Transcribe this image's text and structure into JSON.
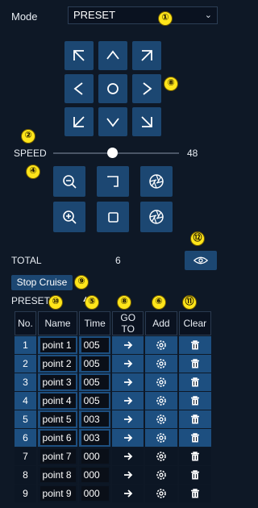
{
  "mode": {
    "label": "Mode",
    "value": "PRESET"
  },
  "speed": {
    "label": "SPEED",
    "value": "48",
    "level_percent": 48
  },
  "total": {
    "label": "TOTAL",
    "value": "6"
  },
  "stop_cruise_label": "Stop Cruise",
  "preset_label": "PRESET",
  "table": {
    "headers": [
      "No.",
      "Name",
      "Time",
      "GO TO",
      "Add",
      "Clear"
    ],
    "rows": [
      {
        "no": "1",
        "name": "point 1",
        "time": "005",
        "active": true
      },
      {
        "no": "2",
        "name": "point 2",
        "time": "005",
        "active": true
      },
      {
        "no": "3",
        "name": "point 3",
        "time": "005",
        "active": true
      },
      {
        "no": "4",
        "name": "point 4",
        "time": "005",
        "active": true
      },
      {
        "no": "5",
        "name": "point 5",
        "time": "003",
        "active": true
      },
      {
        "no": "6",
        "name": "point 6",
        "time": "003",
        "active": true
      },
      {
        "no": "7",
        "name": "point 7",
        "time": "000",
        "active": false
      },
      {
        "no": "8",
        "name": "point 8",
        "time": "000",
        "active": false
      },
      {
        "no": "9",
        "name": "point 9",
        "time": "000",
        "active": false
      }
    ]
  },
  "callouts": [
    "①",
    "②",
    "③",
    "④",
    "⑤",
    "⑥",
    "⑧",
    "⑨",
    "⑩",
    "⑪",
    "⑫"
  ],
  "colors": {
    "button_blue": "#1c4772",
    "callout_yellow": "#ffe51a",
    "active_row": "#1d4f80"
  }
}
